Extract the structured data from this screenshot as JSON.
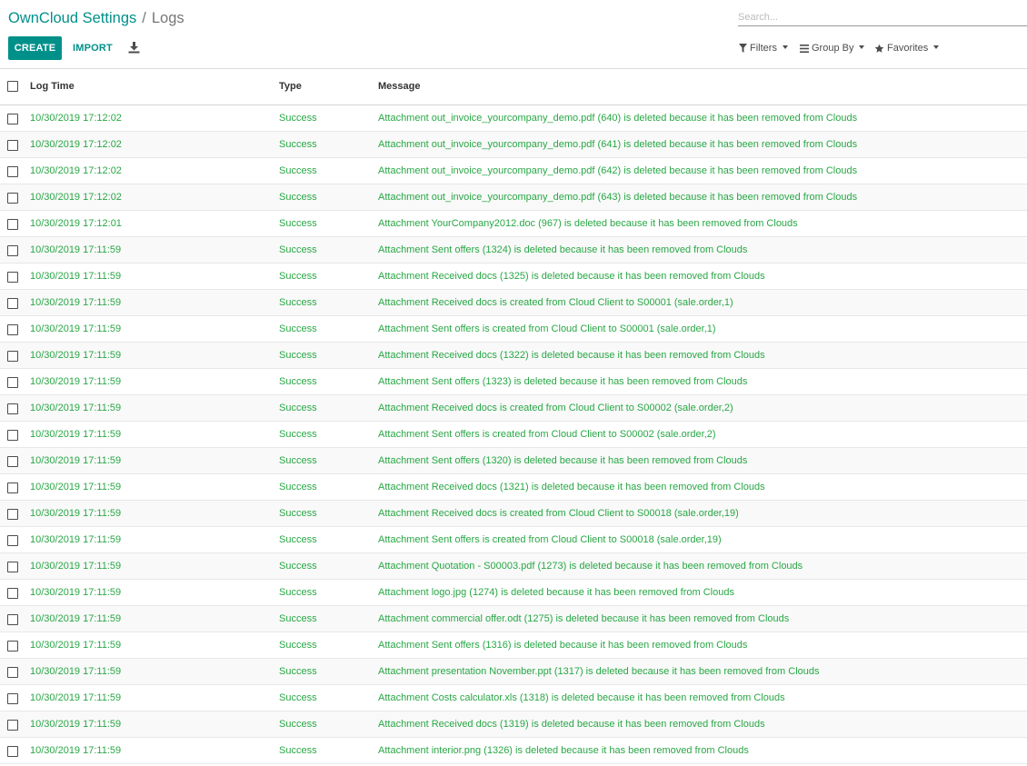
{
  "breadcrumb": {
    "parent": "OwnCloud Settings",
    "separator": "/",
    "current": "Logs"
  },
  "search": {
    "placeholder": "Search..."
  },
  "toolbar": {
    "create_label": "CREATE",
    "import_label": "IMPORT"
  },
  "filters": {
    "filters_label": "Filters",
    "group_by_label": "Group By",
    "favorites_label": "Favorites"
  },
  "table": {
    "columns": [
      "Log Time",
      "Type",
      "Message"
    ],
    "rows": [
      {
        "time": "10/30/2019 17:12:02",
        "type": "Success",
        "message": "Attachment out_invoice_yourcompany_demo.pdf (640) is deleted because it has been removed from Clouds"
      },
      {
        "time": "10/30/2019 17:12:02",
        "type": "Success",
        "message": "Attachment out_invoice_yourcompany_demo.pdf (641) is deleted because it has been removed from Clouds"
      },
      {
        "time": "10/30/2019 17:12:02",
        "type": "Success",
        "message": "Attachment out_invoice_yourcompany_demo.pdf (642) is deleted because it has been removed from Clouds"
      },
      {
        "time": "10/30/2019 17:12:02",
        "type": "Success",
        "message": "Attachment out_invoice_yourcompany_demo.pdf (643) is deleted because it has been removed from Clouds"
      },
      {
        "time": "10/30/2019 17:12:01",
        "type": "Success",
        "message": "Attachment YourCompany2012.doc (967) is deleted because it has been removed from Clouds"
      },
      {
        "time": "10/30/2019 17:11:59",
        "type": "Success",
        "message": "Attachment Sent offers (1324) is deleted because it has been removed from Clouds"
      },
      {
        "time": "10/30/2019 17:11:59",
        "type": "Success",
        "message": "Attachment Received docs (1325) is deleted because it has been removed from Clouds"
      },
      {
        "time": "10/30/2019 17:11:59",
        "type": "Success",
        "message": "Attachment Received docs is created from Cloud Client to S00001 (sale.order,1)"
      },
      {
        "time": "10/30/2019 17:11:59",
        "type": "Success",
        "message": "Attachment Sent offers is created from Cloud Client to S00001 (sale.order,1)"
      },
      {
        "time": "10/30/2019 17:11:59",
        "type": "Success",
        "message": "Attachment Received docs (1322) is deleted because it has been removed from Clouds"
      },
      {
        "time": "10/30/2019 17:11:59",
        "type": "Success",
        "message": "Attachment Sent offers (1323) is deleted because it has been removed from Clouds"
      },
      {
        "time": "10/30/2019 17:11:59",
        "type": "Success",
        "message": "Attachment Received docs is created from Cloud Client to S00002 (sale.order,2)"
      },
      {
        "time": "10/30/2019 17:11:59",
        "type": "Success",
        "message": "Attachment Sent offers is created from Cloud Client to S00002 (sale.order,2)"
      },
      {
        "time": "10/30/2019 17:11:59",
        "type": "Success",
        "message": "Attachment Sent offers (1320) is deleted because it has been removed from Clouds"
      },
      {
        "time": "10/30/2019 17:11:59",
        "type": "Success",
        "message": "Attachment Received docs (1321) is deleted because it has been removed from Clouds"
      },
      {
        "time": "10/30/2019 17:11:59",
        "type": "Success",
        "message": "Attachment Received docs is created from Cloud Client to S00018 (sale.order,19)"
      },
      {
        "time": "10/30/2019 17:11:59",
        "type": "Success",
        "message": "Attachment Sent offers is created from Cloud Client to S00018 (sale.order,19)"
      },
      {
        "time": "10/30/2019 17:11:59",
        "type": "Success",
        "message": "Attachment Quotation - S00003.pdf (1273) is deleted because it has been removed from Clouds"
      },
      {
        "time": "10/30/2019 17:11:59",
        "type": "Success",
        "message": "Attachment logo.jpg (1274) is deleted because it has been removed from Clouds"
      },
      {
        "time": "10/30/2019 17:11:59",
        "type": "Success",
        "message": "Attachment commercial offer.odt (1275) is deleted because it has been removed from Clouds"
      },
      {
        "time": "10/30/2019 17:11:59",
        "type": "Success",
        "message": "Attachment Sent offers (1316) is deleted because it has been removed from Clouds"
      },
      {
        "time": "10/30/2019 17:11:59",
        "type": "Success",
        "message": "Attachment presentation November.ppt (1317) is deleted because it has been removed from Clouds"
      },
      {
        "time": "10/30/2019 17:11:59",
        "type": "Success",
        "message": "Attachment Costs calculator.xls (1318) is deleted because it has been removed from Clouds"
      },
      {
        "time": "10/30/2019 17:11:59",
        "type": "Success",
        "message": "Attachment Received docs (1319) is deleted because it has been removed from Clouds"
      },
      {
        "time": "10/30/2019 17:11:59",
        "type": "Success",
        "message": "Attachment interior.png (1326) is deleted because it has been removed from Clouds"
      }
    ]
  },
  "colors": {
    "accent": "#00908a",
    "success_text": "#28a745",
    "border": "#e7e7e7"
  },
  "icons": {
    "download": "download-icon",
    "filters": "filter-icon",
    "group_by": "bars-icon",
    "favorites": "star-icon",
    "dropdown": "caret-down-icon"
  }
}
